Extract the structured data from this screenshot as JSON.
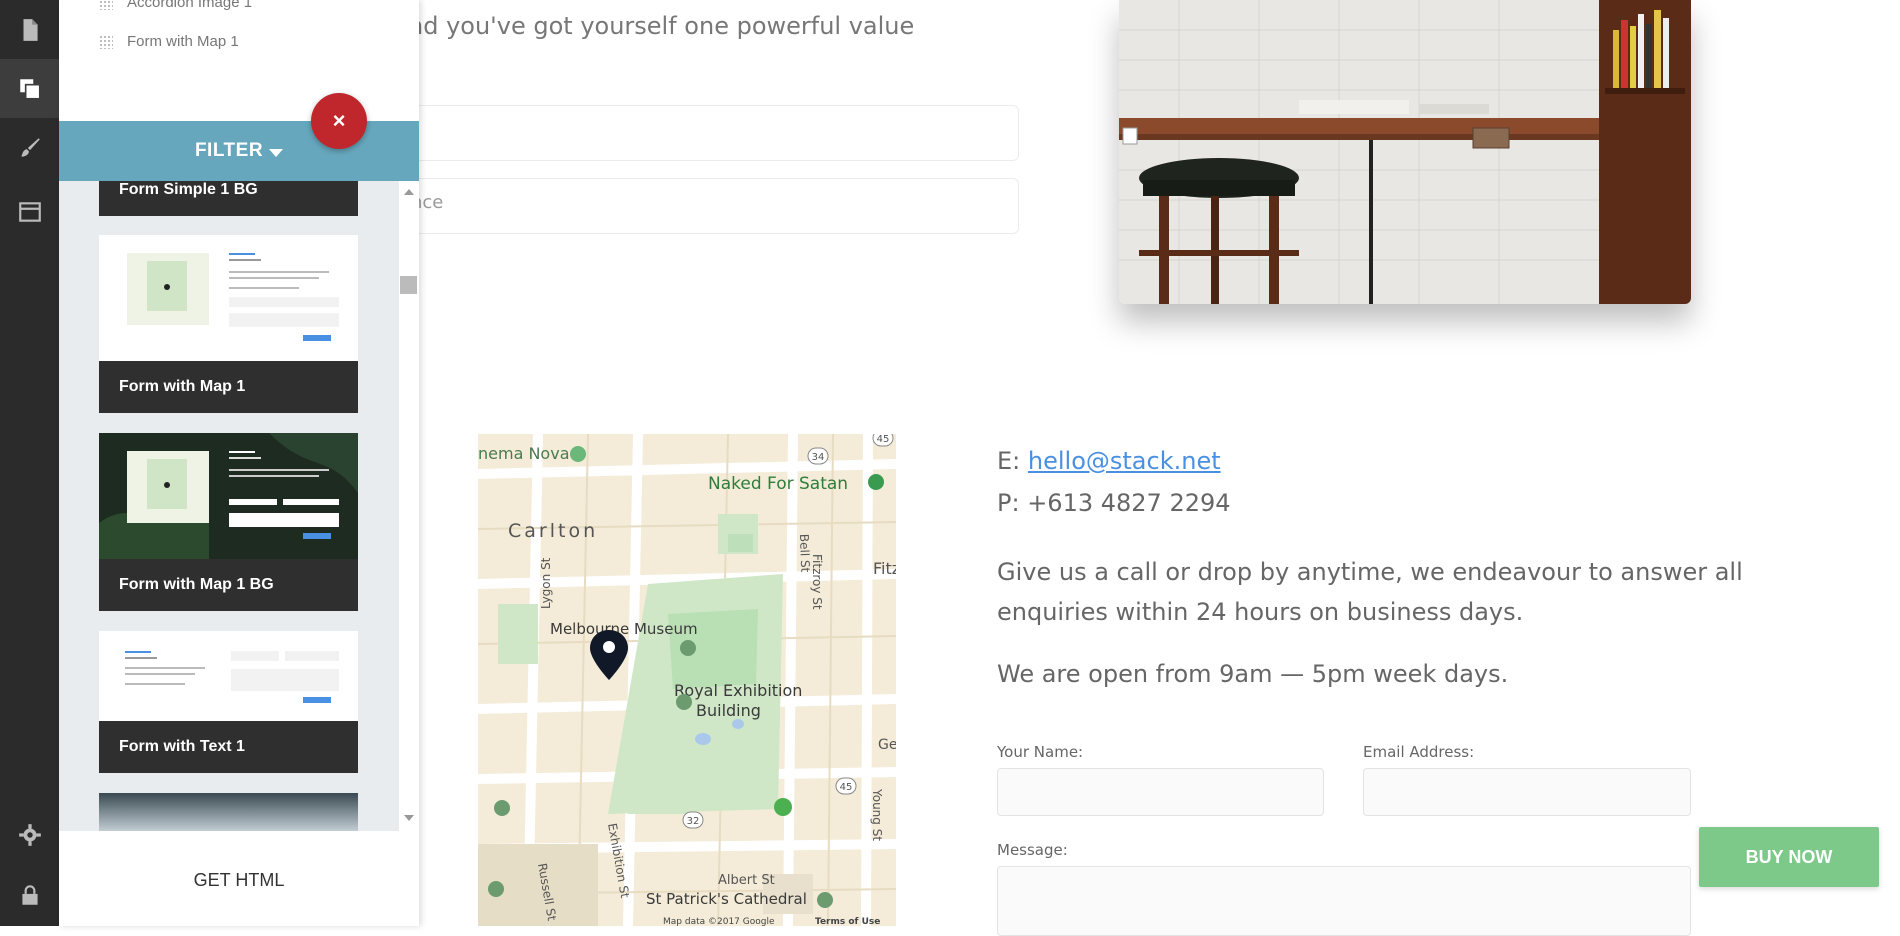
{
  "rail": {
    "icons": [
      "page-icon",
      "layers-icon",
      "brush-icon",
      "window-icon",
      "gear-icon",
      "lock-icon"
    ]
  },
  "panel": {
    "top_items": [
      "Accordion Image 1",
      "Form with Map 1"
    ],
    "filter_label": "FILTER",
    "close_symbol": "×",
    "cards": [
      "Form Simple 1 BG",
      "Form with Map 1",
      "Form with Map 1 BG",
      "Form with Text 1"
    ],
    "get_html": "GET HTML"
  },
  "page": {
    "partial_heading": "nd you've got yourself one powerful value",
    "partial_input": "nce",
    "contact": {
      "email_prefix": "E: ",
      "email": "hello@stack.net",
      "phone": "P: +613 4827 2294",
      "para1": "Give us a call or drop by anytime, we endeavour to answer all enquiries within 24 hours on business days.",
      "para2": "We are open from 9am — 5pm week days."
    },
    "form": {
      "name_label": "Your Name:",
      "email_label": "Email Address:",
      "message_label": "Message:"
    },
    "map": {
      "labels": [
        "nema Nova",
        "Naked For Satan",
        "Carlton",
        "Bell St",
        "Fitz",
        "Melbourne Museum",
        "Royal Exhibition",
        "Building",
        "Lygon St",
        "Fitzroy St",
        "Gen",
        "Exhibition St",
        "Russell St",
        "Albert St",
        "St Patrick's Cathedral",
        "Young St",
        "Map data ©2017 Google",
        "Terms of Use"
      ],
      "badges": [
        "34",
        "45",
        "45",
        "32"
      ]
    },
    "buy_now": "BUY NOW"
  },
  "colors": {
    "rail": "#2b2b2b",
    "filter": "#67a7bd",
    "close": "#c0272d",
    "buy": "#7dc98a",
    "link": "#4a90e2"
  }
}
